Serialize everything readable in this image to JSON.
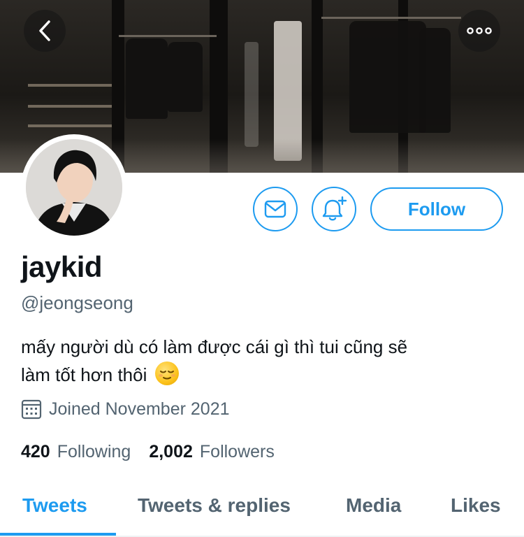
{
  "banner": {
    "back_icon": "chevron-left-icon",
    "more_icon": "more-horizontal-icon"
  },
  "profile": {
    "display_name": "jaykid",
    "handle": "@jeongseong",
    "bio_line1": "mấy người dù có làm được cái gì thì tui cũng sẽ",
    "bio_line2": "làm tốt hơn thôi",
    "bio_emoji": "relieved-face-emoji",
    "joined": "Joined November 2021"
  },
  "actions": {
    "message_icon": "envelope-icon",
    "notify_icon": "bell-plus-icon",
    "follow_label": "Follow"
  },
  "stats": {
    "following_count": "420",
    "following_label": "Following",
    "followers_count": "2,002",
    "followers_label": "Followers"
  },
  "tabs": [
    {
      "label": "Tweets",
      "active": true
    },
    {
      "label": "Tweets & replies",
      "active": false
    },
    {
      "label": "Media",
      "active": false
    },
    {
      "label": "Likes",
      "active": false
    }
  ],
  "colors": {
    "accent": "#1d9bf0",
    "text_primary": "#0f1419",
    "text_secondary": "#536471"
  }
}
